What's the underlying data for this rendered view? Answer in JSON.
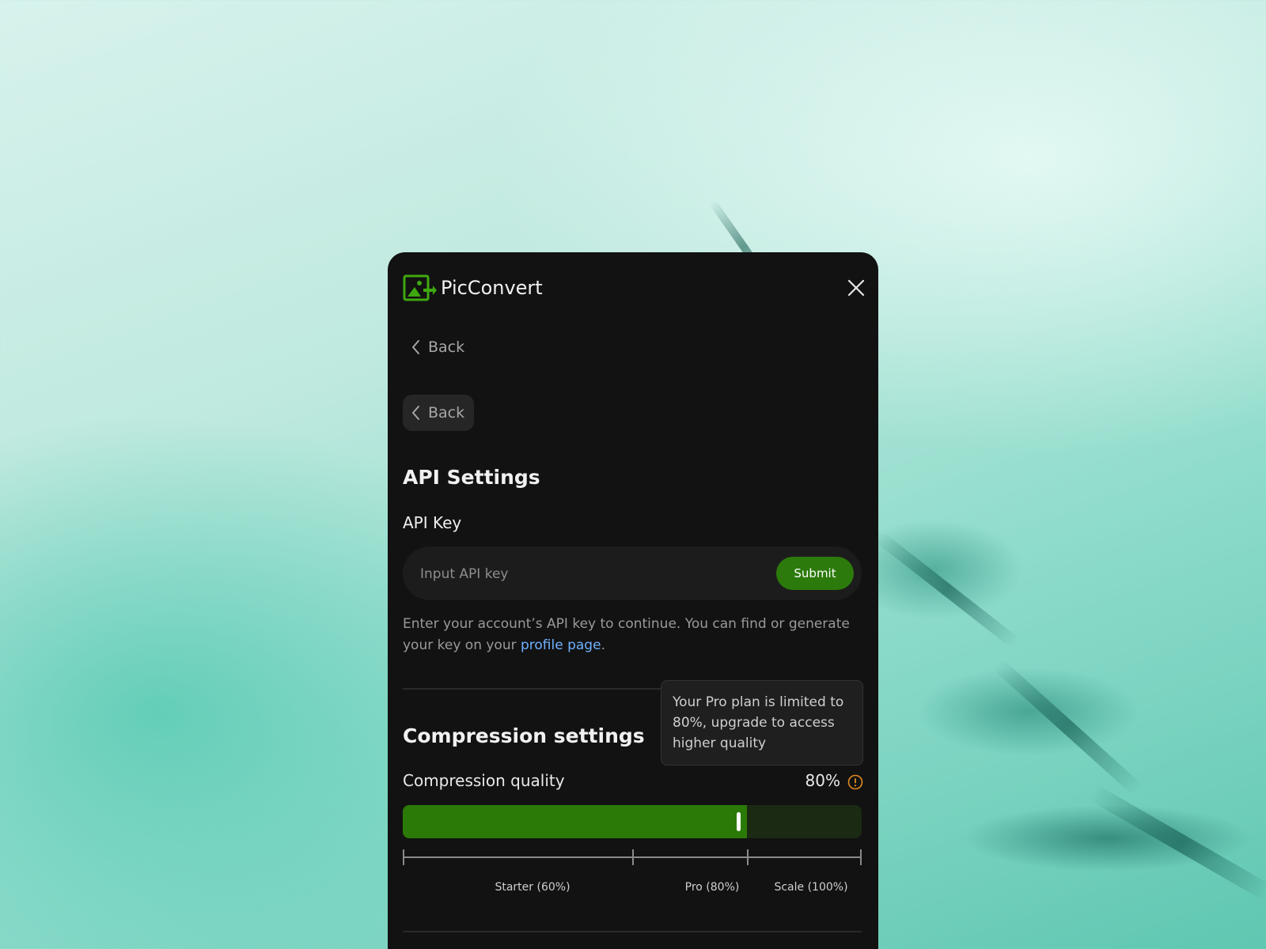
{
  "app": {
    "title": "PicConvert",
    "accent_color": "#2c7a0b",
    "logo_icon": "image-convert-icon"
  },
  "nav": {
    "back_label": "Back",
    "back_pill_label": "Back",
    "close_icon": "close-icon"
  },
  "api_settings": {
    "title": "API Settings",
    "key_label": "API Key",
    "input_value": "",
    "input_placeholder": "Input API key",
    "submit_label": "Submit",
    "help_text_before": "Enter your account’s API key to continue. You can find or generate your key on your ",
    "help_link": "profile page",
    "help_text_after": "."
  },
  "compression": {
    "title": "Compression settings",
    "quality_label": "Compression quality",
    "quality_value_text": "80%",
    "quality_value": 0.8,
    "warning_icon": "warning-circle-icon",
    "warning_color": "#e08a1f",
    "tooltip": "Your Pro plan is limited to 80%, upgrade to access higher quality",
    "plans": [
      {
        "label": "Starter (60%)",
        "value": 0.6
      },
      {
        "label": "Pro (80%)",
        "value": 0.8
      },
      {
        "label": "Scale (100%)",
        "value": 1.0
      }
    ]
  }
}
